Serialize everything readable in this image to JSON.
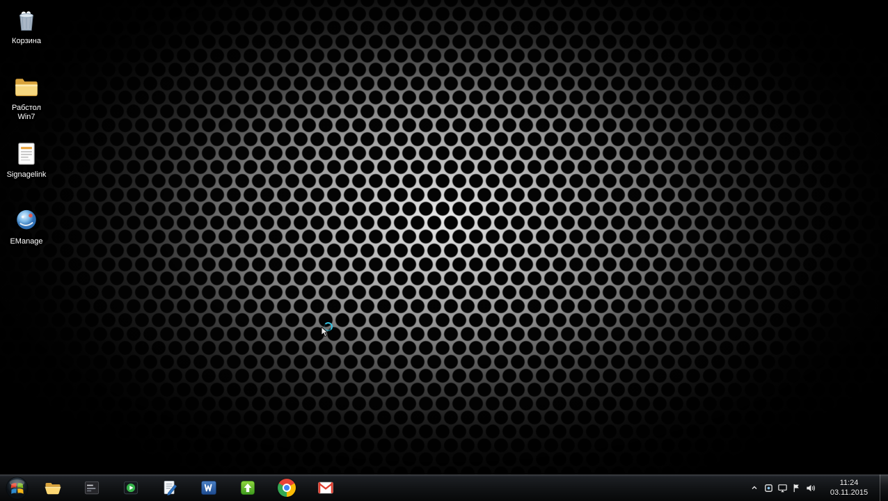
{
  "desktop": {
    "icons": [
      {
        "name": "recycle-bin",
        "label": "Корзина"
      },
      {
        "name": "folder-rabstol-win7",
        "label": "Рабстол",
        "label2": "Win7"
      },
      {
        "name": "signagelink",
        "label": "Signagelink"
      },
      {
        "name": "emanage",
        "label": "EManage"
      }
    ],
    "cursor": "busy-spinner"
  },
  "taskbar": {
    "pinned_icons": [
      "start",
      "windows-explorer",
      "dark-app",
      "media-app",
      "text-editor",
      "microsoft-word",
      "green-arrow-app",
      "google-chrome",
      "gmail"
    ],
    "tray_icons": [
      "hidden-icons-arrow",
      "tray-app",
      "display",
      "action-center-flag",
      "volume"
    ],
    "clock": {
      "time": "11:24",
      "date": "03.11.2015"
    }
  },
  "colors": {
    "taskbar_bg": "#101214",
    "desktop_label": "#ffffff",
    "spinner": "#35c1e0",
    "wallpaper_metal": "#c2c2c2"
  }
}
